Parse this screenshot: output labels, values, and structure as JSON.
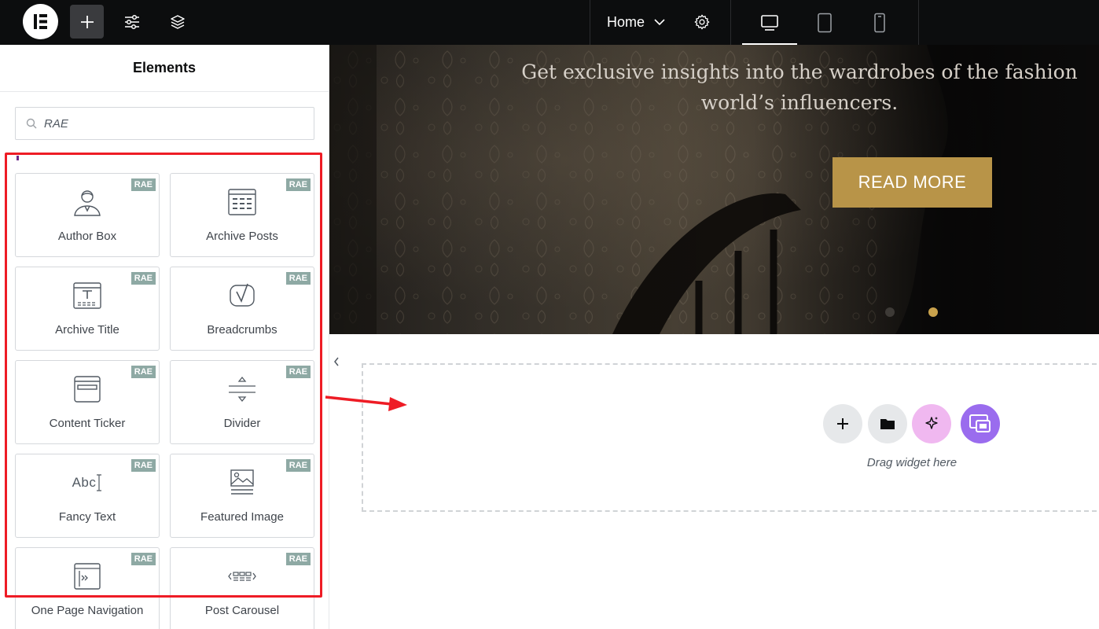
{
  "topbar": {
    "page_name": "Home"
  },
  "panel": {
    "title": "Elements",
    "search_value": "RAE",
    "widgets": [
      {
        "label": "Author Box",
        "badge": "RAE",
        "icon": "author-box-icon"
      },
      {
        "label": "Archive Posts",
        "badge": "RAE",
        "icon": "archive-posts-icon"
      },
      {
        "label": "Archive Title",
        "badge": "RAE",
        "icon": "archive-title-icon"
      },
      {
        "label": "Breadcrumbs",
        "badge": "RAE",
        "icon": "breadcrumbs-icon"
      },
      {
        "label": "Content Ticker",
        "badge": "RAE",
        "icon": "content-ticker-icon"
      },
      {
        "label": "Divider",
        "badge": "RAE",
        "icon": "divider-icon"
      },
      {
        "label": "Fancy Text",
        "badge": "RAE",
        "icon": "fancy-text-icon"
      },
      {
        "label": "Featured Image",
        "badge": "RAE",
        "icon": "featured-image-icon"
      },
      {
        "label": "One Page Navigation",
        "badge": "RAE",
        "icon": "one-page-navigation-icon"
      },
      {
        "label": "Post Carousel",
        "badge": "RAE",
        "icon": "post-carousel-icon"
      }
    ]
  },
  "canvas": {
    "hero_subtitle": "Get exclusive insights into the wardrobes of the fashion world’s influencers.",
    "read_more": "READ MORE",
    "drag_hint": "Drag widget here",
    "fancy_text_sample": "Abc"
  },
  "colors": {
    "topbar_bg": "#0c0d0e",
    "rae_badge": "#8ea9a4",
    "highlight_red": "#ee1c25",
    "button_gold": "#b89448",
    "ai_pink": "#f0b8f0",
    "template_purple": "#9a6cee"
  }
}
